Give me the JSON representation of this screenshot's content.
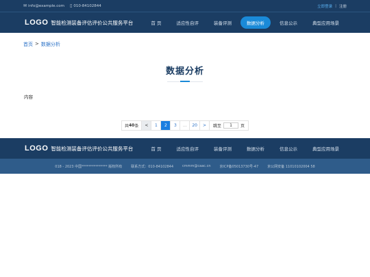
{
  "topbar": {
    "email_icon": "mail-icon",
    "email": "info@example.com",
    "phone_icon": "phone-icon",
    "phone": "010-84102844",
    "login": "立即登录",
    "separator": "|",
    "register": "注册"
  },
  "header": {
    "logo": "LOGO",
    "site_title": "智能检测装备评估评价公共服务平台",
    "nav": [
      {
        "label": "首 页",
        "active": false
      },
      {
        "label": "适应性自评",
        "active": false
      },
      {
        "label": "装备评测",
        "active": false
      },
      {
        "label": "数据分析",
        "active": true
      },
      {
        "label": "信息公示",
        "active": false
      },
      {
        "label": "典型应用场景",
        "active": false
      }
    ]
  },
  "breadcrumb": {
    "home": "首页",
    "sep": ">",
    "current": "数据分析"
  },
  "page": {
    "title": "数据分析",
    "content": "内容"
  },
  "pagination": {
    "total_prefix": "共",
    "total_count": "40",
    "total_suffix": "条",
    "prev": "<",
    "pages": [
      "1",
      "2",
      "3",
      "…",
      "20"
    ],
    "current_page": "2",
    "next": ">",
    "jump_label": "跳至",
    "jump_value": "1",
    "jump_unit": "页"
  },
  "footer": {
    "logo": "LOGO",
    "site_title": "智能检测装备评估评价公共服务平台",
    "nav": [
      {
        "label": "首 页"
      },
      {
        "label": "适应性自评"
      },
      {
        "label": "装备评测"
      },
      {
        "label": "数据分析"
      },
      {
        "label": "信息公示"
      },
      {
        "label": "典型应用场景"
      }
    ],
    "copyright": "018 - 2023 中国*************** 版权所有",
    "contact": "联系方式：010-84102844",
    "email": "cmmm@caac.cn",
    "icp": "京ICP备05013730号-47",
    "police": "京公网安备 11010102004 58"
  },
  "colors": {
    "header_bg": "#1b3d63",
    "accent": "#1a8ad8",
    "copyright_bg": "#2f5c8a",
    "link": "#2b72c7"
  }
}
